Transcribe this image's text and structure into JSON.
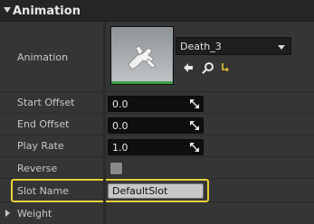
{
  "section": {
    "title": "Animation"
  },
  "animation": {
    "label": "Animation",
    "asset": "Death_3"
  },
  "properties": {
    "start_offset": {
      "label": "Start Offset",
      "value": "0.0"
    },
    "end_offset": {
      "label": "End Offset",
      "value": "0.0"
    },
    "play_rate": {
      "label": "Play Rate",
      "value": "1.0"
    },
    "reverse": {
      "label": "Reverse",
      "checked": false
    },
    "slot_name": {
      "label": "Slot Name",
      "value": "DefaultSlot"
    },
    "weight": {
      "label": "Weight"
    }
  },
  "colors": {
    "highlight": "#e8d13a",
    "thumbnail_bar": "#3aa043",
    "browse_icon": "#e8c830"
  }
}
